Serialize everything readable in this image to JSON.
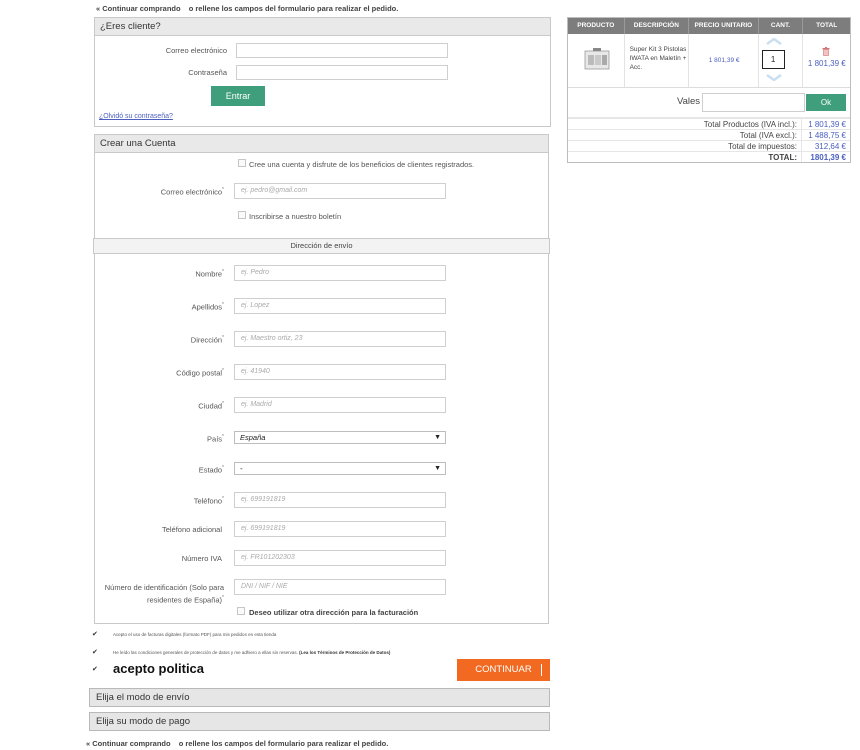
{
  "nav": {
    "continue_link": "« Continuar comprando",
    "or_fill_text": "o rellene los campos del formulario para realizar el pedido."
  },
  "login": {
    "title": "¿Eres cliente?",
    "email_label": "Correo electrónico",
    "password_label": "Contraseña",
    "submit_label": "Entrar",
    "forgot_link": "¿Olvidó su contraseña?"
  },
  "account": {
    "title": "Crear una Cuenta",
    "create_checkbox_label": "Cree una cuenta y disfrute de los beneficios de clientes registrados.",
    "email_label": "Correo electrónico",
    "email_placeholder": "ej. pedro@gmail.com",
    "newsletter_label": "Inscribirse a nuestro boletín",
    "shipping_title": "Dirección de envío",
    "fields": [
      {
        "label": "Nombre",
        "required": true,
        "placeholder": "ej. Pedro"
      },
      {
        "label": "Apellidos",
        "required": true,
        "placeholder": "ej. Lopez"
      },
      {
        "label": "Dirección",
        "required": true,
        "placeholder": "ej. Maestro ortiz, 23"
      },
      {
        "label": "Código postal",
        "required": true,
        "placeholder": "ej. 41940"
      },
      {
        "label": "Ciudad",
        "required": true,
        "placeholder": "ej. Madrid"
      }
    ],
    "country_label": "País",
    "country_value": "España",
    "state_label": "Estado",
    "state_value": "-",
    "phone_label": "Teléfono",
    "phone_placeholder": "ej. 699191819",
    "phone2_label": "Teléfono adicional",
    "phone2_placeholder": "ej. 699191819",
    "vat_label": "Número IVA",
    "vat_placeholder": "ej. FR101202303",
    "id_label_line1": "Número de identificación (Solo para",
    "id_label_line2": "residentes de España)",
    "id_placeholder": "DNI / NIF / NIE",
    "billing_checkbox_label": "Deseo utilizar otra dirección para la facturación"
  },
  "consents": {
    "pdf_invoices": "Acepto el uso de facturas digitales (formato PDF) para mis pedidos en esta tienda",
    "privacy_text": "He leído las condiciones generales de protección de datos y me adhiero a ellas sin reservas.",
    "privacy_link": "(Lea los Términos de Protección de Datos)",
    "policy": "acepto politica",
    "check_glyph": "✔"
  },
  "continue_button": "CONTINUAR",
  "shipping_mode": "Elija el modo de envío",
  "payment_mode": "Elija su modo de pago",
  "cart": {
    "headers": [
      "PRODUCTO",
      "DESCRIPCIÓN",
      "PRECIO UNITARIO",
      "CANT.",
      "TOTAL"
    ],
    "item": {
      "description": "Super Kit 3 Pistolas IWATA en Maletín + Acc.",
      "unit_price": "1 801,39 €",
      "quantity": "1",
      "total": "1 801,39 €"
    },
    "voucher_label": "Vales",
    "voucher_button": "Ok",
    "summary": [
      {
        "label": "Total Productos (IVA incl.):",
        "value": "1 801,39 €"
      },
      {
        "label": "Total (IVA excl.):",
        "value": "1 488,75 €"
      },
      {
        "label": "Total de impuestos:",
        "value": "312,64 €"
      },
      {
        "label": "TOTAL:",
        "value": "1801,39 €"
      }
    ]
  },
  "colors": {
    "accent_green": "#3f9e7c",
    "accent_orange": "#f26a21",
    "link_blue": "#4a5fbf",
    "table_header": "#7d7d7d"
  }
}
